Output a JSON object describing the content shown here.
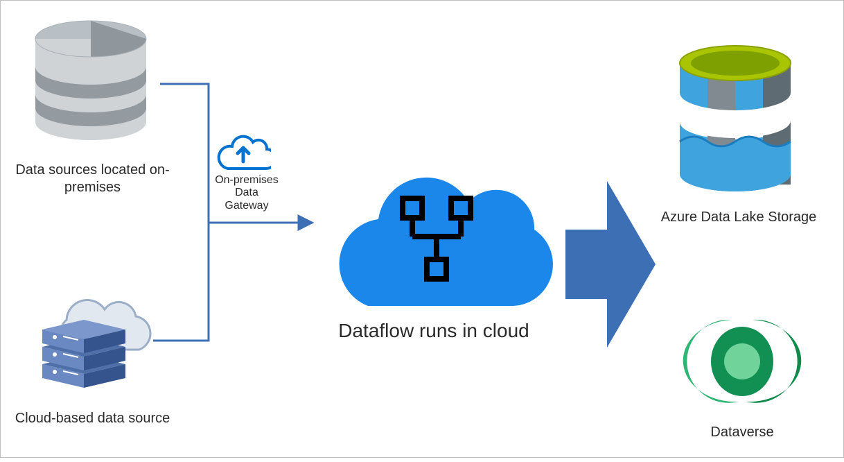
{
  "labels": {
    "onprem_source": "Data sources located on-premises",
    "cloud_source": "Cloud-based data source",
    "gateway_line1": "On-premises",
    "gateway_line2": "Data Gateway",
    "dataflow": "Dataflow runs in cloud",
    "adls": "Azure Data Lake Storage",
    "dataverse": "Dataverse"
  },
  "colors": {
    "connector": "#3d6fb5",
    "cloud": "#1b87ea",
    "arrow": "#3d6fb5",
    "db_light": "#cfd3d6",
    "db_dark": "#939ba0",
    "adls_green": "#a9c400",
    "adls_gray": "#808a90",
    "adls_blue": "#3fa3dd",
    "adls_white": "#ffffff",
    "dv_dark": "#0e8a4b",
    "dv_mid": "#2fb574",
    "dv_light": "#7ed9a6"
  }
}
